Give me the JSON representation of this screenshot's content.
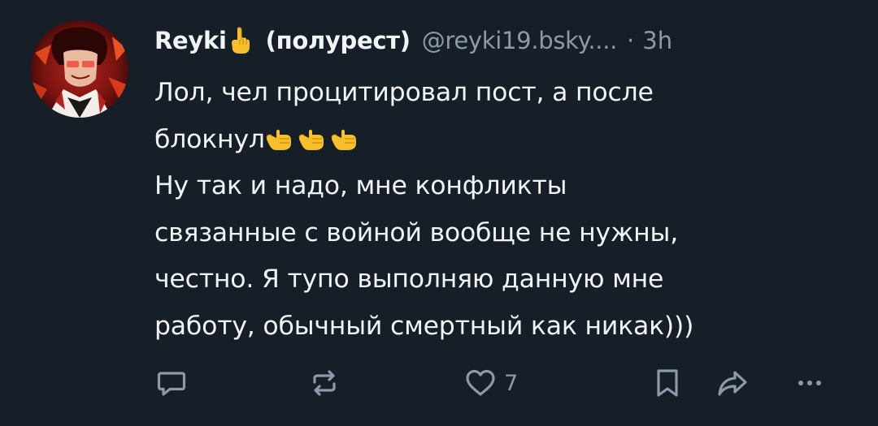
{
  "post": {
    "author": {
      "display_name": "Reyki",
      "name_emoji": "index-pointing-up-emoji",
      "display_name_suffix": "(полурест)",
      "handle": "@reyki19.bsky....",
      "separator": "·",
      "time": "3h"
    },
    "text": {
      "line1": "Лол, чел процитировал пост, а после",
      "line2": "блокнул",
      "line2_emoji": [
        "call-me-hand-emoji",
        "call-me-hand-emoji",
        "call-me-hand-emoji"
      ],
      "line3": "Ну так и надо, мне конфликты",
      "line4": "связанные с войной вообще не нужны,",
      "line5": "честно. Я тупо выполняю данную мне",
      "line6": "работу, обычный смертный как никак)))"
    },
    "actions": {
      "reply_icon": "reply-icon",
      "repost_icon": "repost-icon",
      "like_icon": "heart-icon",
      "like_count": "7",
      "bookmark_icon": "bookmark-icon",
      "share_icon": "share-icon",
      "more_icon": "more-icon"
    },
    "colors": {
      "background": "#161e27",
      "text": "#f1f3f5",
      "muted": "#8d99a8",
      "emoji_yellow": "#f7bf2a"
    }
  }
}
